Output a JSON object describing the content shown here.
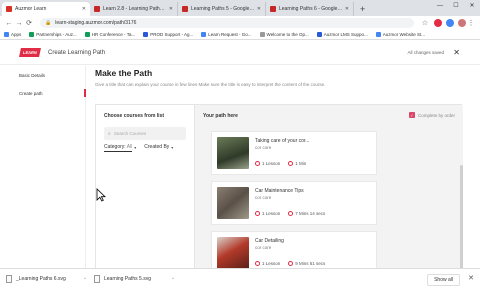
{
  "browser": {
    "tabs": [
      {
        "label": "Auzmor Learn",
        "favicon": "red",
        "active": true
      },
      {
        "label": "Learn 2.8 - Learning Paths - Go...",
        "favicon": "doc",
        "active": false
      },
      {
        "label": "Learning Paths 5 - Google Draw...",
        "favicon": "doc",
        "active": false
      },
      {
        "label": "Learning Paths 6 - Google Draw...",
        "favicon": "doc",
        "active": false
      }
    ],
    "new_tab": "+",
    "url": "learn-staging.auzmor.com/path/3176",
    "bookmarks": [
      "Apps",
      "Partnerships - Auz...",
      "HR Conference - Ta...",
      "PROD Support - Ag...",
      "Learn Request - Go...",
      "Welcome to the Op...",
      "Auzmor LMS Suppo...",
      "Auzmor Website St..."
    ]
  },
  "header": {
    "logo_text": "LEARN",
    "title": "Create Learning Path",
    "status": "All changes saved"
  },
  "sidebar": {
    "items": [
      {
        "label": "Basic Details"
      },
      {
        "label": "Create path"
      }
    ]
  },
  "main": {
    "title": "Make the Path",
    "subtitle": "Give a title that can explain your course in few lines Make sure the title is easy to interpret the content of the course.",
    "left": {
      "heading": "Choose courses from list",
      "search_placeholder": "Search Courses",
      "filter_category": "Category:",
      "filter_category_value": "All",
      "filter_created": "Created By"
    },
    "right": {
      "heading": "Your path here",
      "complete_label": "Complete by order",
      "courses": [
        {
          "title": "Taking care of your cor...",
          "category": "cor core",
          "lessons": "1 Lesson",
          "duration": "1 Min",
          "thumb": "#4a5a3e"
        },
        {
          "title": "Car Maintenance Tips",
          "category": "cor core",
          "lessons": "1 Lesson",
          "duration": "7 Mins 14 secs",
          "thumb": "#7a6a5a"
        },
        {
          "title": "Car Detailing",
          "category": "cor core",
          "lessons": "1 Lesson",
          "duration": "9 Mins 51 secs",
          "thumb": "#b33a2a"
        }
      ]
    }
  },
  "downloads": {
    "items": [
      "_Learning Paths 6.svg",
      "Learning Paths 5.svg"
    ],
    "show_all": "Show all"
  }
}
